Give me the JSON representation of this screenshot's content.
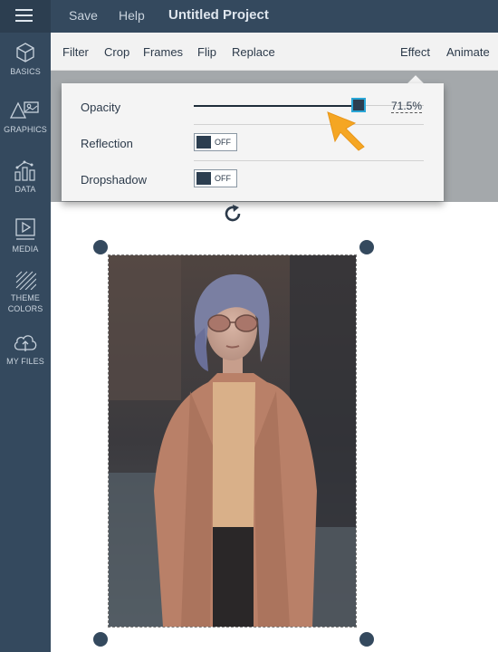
{
  "topbar": {
    "save": "Save",
    "help": "Help",
    "title": "Untitled Project"
  },
  "sidebar": {
    "items": [
      {
        "label": "BASICS",
        "icon": "cube-icon"
      },
      {
        "label": "GRAPHICS",
        "icon": "shapes-icon"
      },
      {
        "label": "DATA",
        "icon": "chart-icon"
      },
      {
        "label": "MEDIA",
        "icon": "play-icon"
      },
      {
        "label_line1": "THEME",
        "label_line2": "COLORS",
        "icon": "stripes-icon"
      },
      {
        "label": "MY FILES",
        "icon": "cloud-upload-icon"
      }
    ]
  },
  "toolbar": {
    "filter": "Filter",
    "crop": "Crop",
    "frames": "Frames",
    "flip": "Flip",
    "replace": "Replace",
    "effect": "Effect",
    "animate": "Animate"
  },
  "effect_panel": {
    "opacity_label": "Opacity",
    "opacity_value": "71.5%",
    "opacity_fraction": 0.715,
    "reflection_label": "Reflection",
    "reflection_state": "OFF",
    "dropshadow_label": "Dropshadow",
    "dropshadow_state": "OFF"
  },
  "colors": {
    "sidebar": "#34495e",
    "accent": "#2aa6d6",
    "cursor": "#f5a623"
  }
}
